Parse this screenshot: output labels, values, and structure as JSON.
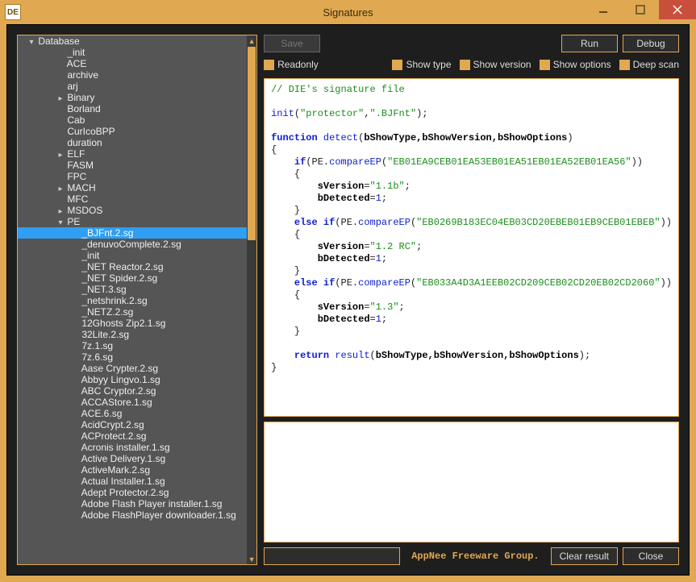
{
  "window": {
    "title": "Signatures",
    "icon_text": "DE"
  },
  "buttons": {
    "save": "Save",
    "run": "Run",
    "debug": "Debug",
    "clear_result": "Clear result",
    "close": "Close"
  },
  "options": {
    "readonly": "Readonly",
    "show_type": "Show type",
    "show_version": "Show version",
    "show_options": "Show options",
    "deep_scan": "Deep scan"
  },
  "branding": "AppNee Freeware Group.",
  "tree": {
    "root": {
      "label": "Database",
      "expanded": true
    },
    "items": [
      {
        "indent": 2,
        "label": "_init"
      },
      {
        "indent": 2,
        "label": "ACE"
      },
      {
        "indent": 2,
        "label": "archive"
      },
      {
        "indent": 2,
        "label": "arj"
      },
      {
        "indent": 2,
        "label": "Binary",
        "exp": "▸"
      },
      {
        "indent": 2,
        "label": "Borland"
      },
      {
        "indent": 2,
        "label": "Cab"
      },
      {
        "indent": 2,
        "label": "CurIcoBPP"
      },
      {
        "indent": 2,
        "label": "duration"
      },
      {
        "indent": 2,
        "label": "ELF",
        "exp": "▸"
      },
      {
        "indent": 2,
        "label": "FASM"
      },
      {
        "indent": 2,
        "label": "FPC"
      },
      {
        "indent": 2,
        "label": "MACH",
        "exp": "▸"
      },
      {
        "indent": 2,
        "label": "MFC"
      },
      {
        "indent": 2,
        "label": "MSDOS",
        "exp": "▸"
      },
      {
        "indent": 2,
        "label": "PE",
        "exp": "▾"
      },
      {
        "indent": 3,
        "label": "_BJFnt.2.sg",
        "selected": true
      },
      {
        "indent": 3,
        "label": "_denuvoComplete.2.sg"
      },
      {
        "indent": 3,
        "label": "_init"
      },
      {
        "indent": 3,
        "label": "_NET Reactor.2.sg"
      },
      {
        "indent": 3,
        "label": "_NET Spider.2.sg"
      },
      {
        "indent": 3,
        "label": "_NET.3.sg"
      },
      {
        "indent": 3,
        "label": "_netshrink.2.sg"
      },
      {
        "indent": 3,
        "label": "_NETZ.2.sg"
      },
      {
        "indent": 3,
        "label": "12Ghosts Zip2.1.sg"
      },
      {
        "indent": 3,
        "label": "32Lite.2.sg"
      },
      {
        "indent": 3,
        "label": "7z.1.sg"
      },
      {
        "indent": 3,
        "label": "7z.6.sg"
      },
      {
        "indent": 3,
        "label": "Aase Crypter.2.sg"
      },
      {
        "indent": 3,
        "label": "Abbyy Lingvo.1.sg"
      },
      {
        "indent": 3,
        "label": "ABC Cryptor.2.sg"
      },
      {
        "indent": 3,
        "label": "ACCAStore.1.sg"
      },
      {
        "indent": 3,
        "label": "ACE.6.sg"
      },
      {
        "indent": 3,
        "label": "AcidCrypt.2.sg"
      },
      {
        "indent": 3,
        "label": "ACProtect.2.sg"
      },
      {
        "indent": 3,
        "label": "Acronis installer.1.sg"
      },
      {
        "indent": 3,
        "label": "Active Delivery.1.sg"
      },
      {
        "indent": 3,
        "label": "ActiveMark.2.sg"
      },
      {
        "indent": 3,
        "label": "Actual Installer.1.sg"
      },
      {
        "indent": 3,
        "label": "Adept Protector.2.sg"
      },
      {
        "indent": 3,
        "label": "Adobe Flash Player installer.1.sg"
      },
      {
        "indent": 3,
        "label": "Adobe FlashPlayer downloader.1.sg"
      }
    ]
  },
  "code": {
    "l1": "// DIE's signature file",
    "l2a": "init",
    "l2b": "\"protector\"",
    "l2c": "\".BJFnt\"",
    "l3a": "function ",
    "l3b": "detect",
    "l3c": "bShowType,bShowVersion,bShowOptions",
    "l4": "{",
    "l5a": "    if",
    "l5b": "PE",
    "l5c": "compareEP",
    "l5d": "\"EB01EA9CEB01EA53EB01EA51EB01EA52EB01EA56\"",
    "l6": "    {",
    "l7a": "        sVersion",
    "l7b": "\"1.1b\"",
    "l8a": "        bDetected",
    "l8b": "1",
    "l9": "    }",
    "l10a": "    else if",
    "l10d": "\"EB0269B183EC04EB03CD20EBEB01EB9CEB01EBEB\"",
    "l11": "    {",
    "l12b": "\"1.2 RC\"",
    "l13": "    }",
    "l14a": "    else if",
    "l14d": "\"EB033A4D3A1EEB02CD209CEB02CD20EB02CD2060\"",
    "l15": "    {",
    "l16b": "\"1.3\"",
    "l17": "    }",
    "l18": "",
    "l19a": "    return ",
    "l19b": "result",
    "l19c": "bShowType,bShowVersion,bShowOptions",
    "l20": "}"
  }
}
